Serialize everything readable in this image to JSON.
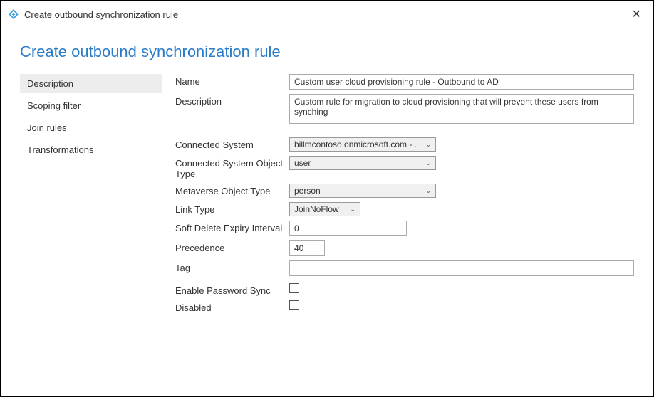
{
  "window": {
    "title": "Create outbound synchronization rule"
  },
  "page": {
    "title": "Create outbound synchronization rule"
  },
  "sidebar": {
    "items": [
      {
        "label": "Description"
      },
      {
        "label": "Scoping filter"
      },
      {
        "label": "Join rules"
      },
      {
        "label": "Transformations"
      }
    ]
  },
  "form": {
    "name": {
      "label": "Name",
      "value": "Custom user cloud provisioning rule - Outbound to AD"
    },
    "description": {
      "label": "Description",
      "value": "Custom rule for migration to cloud provisioning that will prevent these users from synching"
    },
    "connected_system": {
      "label": "Connected System",
      "value": "billmcontoso.onmicrosoft.com - ."
    },
    "cs_object_type": {
      "label": "Connected System Object Type",
      "value": "user"
    },
    "mv_object_type": {
      "label": "Metaverse Object Type",
      "value": "person"
    },
    "link_type": {
      "label": "Link Type",
      "value": "JoinNoFlow"
    },
    "soft_delete": {
      "label": "Soft Delete Expiry Interval",
      "value": "0"
    },
    "precedence": {
      "label": "Precedence",
      "value": "40"
    },
    "tag": {
      "label": "Tag",
      "value": ""
    },
    "enable_pwd_sync": {
      "label": "Enable Password Sync"
    },
    "disabled": {
      "label": "Disabled"
    }
  }
}
